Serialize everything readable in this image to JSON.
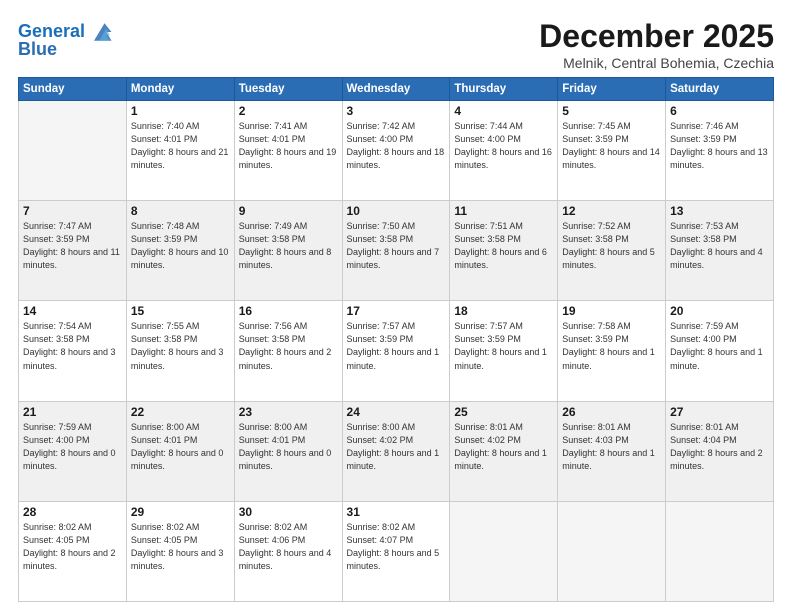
{
  "logo": {
    "line1": "General",
    "line2": "Blue"
  },
  "header": {
    "month": "December 2025",
    "location": "Melnik, Central Bohemia, Czechia"
  },
  "weekdays": [
    "Sunday",
    "Monday",
    "Tuesday",
    "Wednesday",
    "Thursday",
    "Friday",
    "Saturday"
  ],
  "weeks": [
    [
      {
        "day": "",
        "content": ""
      },
      {
        "day": "1",
        "content": "Sunrise: 7:40 AM\nSunset: 4:01 PM\nDaylight: 8 hours\nand 21 minutes."
      },
      {
        "day": "2",
        "content": "Sunrise: 7:41 AM\nSunset: 4:01 PM\nDaylight: 8 hours\nand 19 minutes."
      },
      {
        "day": "3",
        "content": "Sunrise: 7:42 AM\nSunset: 4:00 PM\nDaylight: 8 hours\nand 18 minutes."
      },
      {
        "day": "4",
        "content": "Sunrise: 7:44 AM\nSunset: 4:00 PM\nDaylight: 8 hours\nand 16 minutes."
      },
      {
        "day": "5",
        "content": "Sunrise: 7:45 AM\nSunset: 3:59 PM\nDaylight: 8 hours\nand 14 minutes."
      },
      {
        "day": "6",
        "content": "Sunrise: 7:46 AM\nSunset: 3:59 PM\nDaylight: 8 hours\nand 13 minutes."
      }
    ],
    [
      {
        "day": "7",
        "content": "Sunrise: 7:47 AM\nSunset: 3:59 PM\nDaylight: 8 hours\nand 11 minutes."
      },
      {
        "day": "8",
        "content": "Sunrise: 7:48 AM\nSunset: 3:59 PM\nDaylight: 8 hours\nand 10 minutes."
      },
      {
        "day": "9",
        "content": "Sunrise: 7:49 AM\nSunset: 3:58 PM\nDaylight: 8 hours\nand 8 minutes."
      },
      {
        "day": "10",
        "content": "Sunrise: 7:50 AM\nSunset: 3:58 PM\nDaylight: 8 hours\nand 7 minutes."
      },
      {
        "day": "11",
        "content": "Sunrise: 7:51 AM\nSunset: 3:58 PM\nDaylight: 8 hours\nand 6 minutes."
      },
      {
        "day": "12",
        "content": "Sunrise: 7:52 AM\nSunset: 3:58 PM\nDaylight: 8 hours\nand 5 minutes."
      },
      {
        "day": "13",
        "content": "Sunrise: 7:53 AM\nSunset: 3:58 PM\nDaylight: 8 hours\nand 4 minutes."
      }
    ],
    [
      {
        "day": "14",
        "content": "Sunrise: 7:54 AM\nSunset: 3:58 PM\nDaylight: 8 hours\nand 3 minutes."
      },
      {
        "day": "15",
        "content": "Sunrise: 7:55 AM\nSunset: 3:58 PM\nDaylight: 8 hours\nand 3 minutes."
      },
      {
        "day": "16",
        "content": "Sunrise: 7:56 AM\nSunset: 3:58 PM\nDaylight: 8 hours\nand 2 minutes."
      },
      {
        "day": "17",
        "content": "Sunrise: 7:57 AM\nSunset: 3:59 PM\nDaylight: 8 hours\nand 1 minute."
      },
      {
        "day": "18",
        "content": "Sunrise: 7:57 AM\nSunset: 3:59 PM\nDaylight: 8 hours\nand 1 minute."
      },
      {
        "day": "19",
        "content": "Sunrise: 7:58 AM\nSunset: 3:59 PM\nDaylight: 8 hours\nand 1 minute."
      },
      {
        "day": "20",
        "content": "Sunrise: 7:59 AM\nSunset: 4:00 PM\nDaylight: 8 hours\nand 1 minute."
      }
    ],
    [
      {
        "day": "21",
        "content": "Sunrise: 7:59 AM\nSunset: 4:00 PM\nDaylight: 8 hours\nand 0 minutes."
      },
      {
        "day": "22",
        "content": "Sunrise: 8:00 AM\nSunset: 4:01 PM\nDaylight: 8 hours\nand 0 minutes."
      },
      {
        "day": "23",
        "content": "Sunrise: 8:00 AM\nSunset: 4:01 PM\nDaylight: 8 hours\nand 0 minutes."
      },
      {
        "day": "24",
        "content": "Sunrise: 8:00 AM\nSunset: 4:02 PM\nDaylight: 8 hours\nand 1 minute."
      },
      {
        "day": "25",
        "content": "Sunrise: 8:01 AM\nSunset: 4:02 PM\nDaylight: 8 hours\nand 1 minute."
      },
      {
        "day": "26",
        "content": "Sunrise: 8:01 AM\nSunset: 4:03 PM\nDaylight: 8 hours\nand 1 minute."
      },
      {
        "day": "27",
        "content": "Sunrise: 8:01 AM\nSunset: 4:04 PM\nDaylight: 8 hours\nand 2 minutes."
      }
    ],
    [
      {
        "day": "28",
        "content": "Sunrise: 8:02 AM\nSunset: 4:05 PM\nDaylight: 8 hours\nand 2 minutes."
      },
      {
        "day": "29",
        "content": "Sunrise: 8:02 AM\nSunset: 4:05 PM\nDaylight: 8 hours\nand 3 minutes."
      },
      {
        "day": "30",
        "content": "Sunrise: 8:02 AM\nSunset: 4:06 PM\nDaylight: 8 hours\nand 4 minutes."
      },
      {
        "day": "31",
        "content": "Sunrise: 8:02 AM\nSunset: 4:07 PM\nDaylight: 8 hours\nand 5 minutes."
      },
      {
        "day": "",
        "content": ""
      },
      {
        "day": "",
        "content": ""
      },
      {
        "day": "",
        "content": ""
      }
    ]
  ]
}
